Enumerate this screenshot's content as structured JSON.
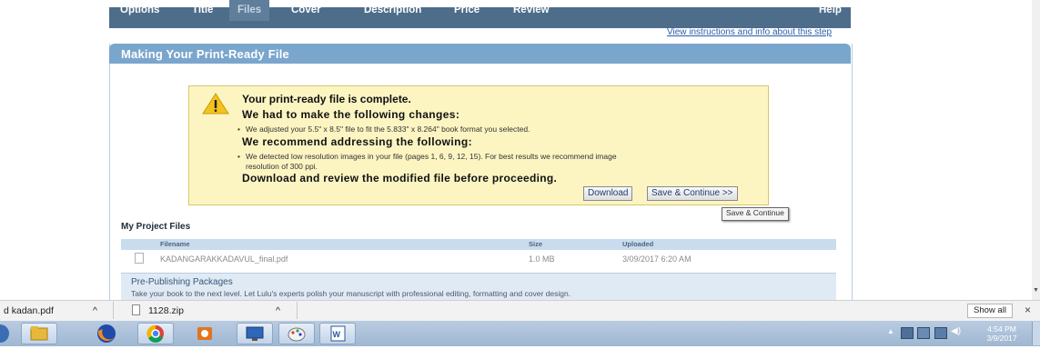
{
  "nav": {
    "items": [
      "Options",
      "Title",
      "Files",
      "Cover",
      "Description",
      "Price",
      "Review"
    ],
    "help": "Help",
    "instructions_link": "View instructions and info about this step"
  },
  "panel": {
    "title": "Making Your Print-Ready File"
  },
  "notice": {
    "complete": "Your print-ready file is complete.",
    "changes_heading": "We had to make the following changes:",
    "change_1": "We adjusted your 5.5\" x 8.5\" file to fit the 5.833\" x 8.264\" book format you selected.",
    "recommend_heading": "We recommend addressing the following:",
    "recommend_1a": "We detected low resolution images in your file (pages 1, 6, 9, 12, 15). For best results we recommend image",
    "recommend_1b": "resolution of 300 ppi.",
    "download_heading": "Download and review the modified file before proceeding.",
    "download_button": "Download",
    "save_button": "Save & Continue >>"
  },
  "tooltip": "Save & Continue",
  "files": {
    "title": "My Project Files",
    "headers": {
      "filename": "Filename",
      "size": "Size",
      "uploaded": "Uploaded"
    },
    "rows": [
      {
        "filename": "KADANGARAKKADAVUL_final.pdf",
        "size": "1.0 MB",
        "uploaded": "3/09/2017 6:20 AM"
      }
    ]
  },
  "prepub": {
    "title": "Pre-Publishing Packages",
    "text": "Take your book to the next level. Let Lulu's experts polish your manuscript with professional editing, formatting and cover design."
  },
  "downloads": {
    "item1": "d kadan.pdf",
    "item2": "1128.zip",
    "caret": "^",
    "show_all": "Show all",
    "close": "×"
  },
  "taskbar": {
    "time": "4:54 PM",
    "date": "3/9/2017"
  },
  "colors": {
    "nav_bg": "#4e6d8a",
    "panel_header": "#7aa6cd",
    "notice_bg": "#fcf5c2",
    "link": "#2a5ea8"
  }
}
